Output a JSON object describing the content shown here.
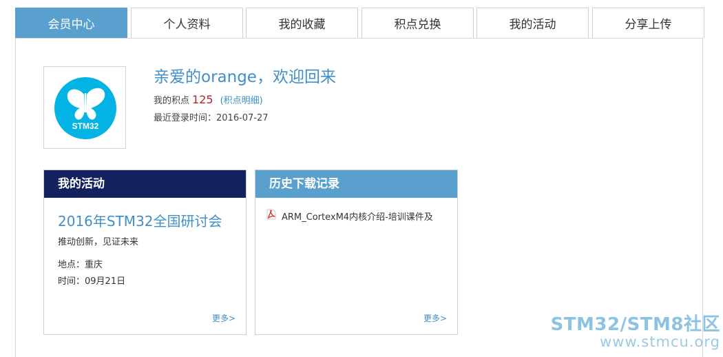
{
  "tabs": [
    {
      "label": "会员中心",
      "active": true
    },
    {
      "label": "个人资料",
      "active": false
    },
    {
      "label": "我的收藏",
      "active": false
    },
    {
      "label": "积点兑换",
      "active": false
    },
    {
      "label": "我的活动",
      "active": false
    },
    {
      "label": "分享上传",
      "active": false
    }
  ],
  "profile": {
    "avatar_label": "STM32",
    "welcome": "亲爱的orange，欢迎回来",
    "points_label": "我的积点",
    "points_value": "125",
    "points_detail": "(积点明细)",
    "last_login": "最近登录时间：2016-07-27"
  },
  "activity": {
    "header": "我的活动",
    "title": "2016年STM32全国研讨会",
    "slogan": "推动创新，见证未来",
    "place": "地点：重庆",
    "time": "时间：09月21日",
    "more": "更多>"
  },
  "history": {
    "header": "历史下载记录",
    "items": [
      "ARM_CortexM4内核介绍-培训课件及"
    ],
    "more": "更多>"
  },
  "watermark": {
    "brand": "STM32/STM8社区",
    "url": "www.stmcu.org"
  },
  "colors": {
    "accent": "#5aa0cf",
    "link": "#3f8fc9",
    "activity_header": "#13215e",
    "points": "#b3232b"
  }
}
